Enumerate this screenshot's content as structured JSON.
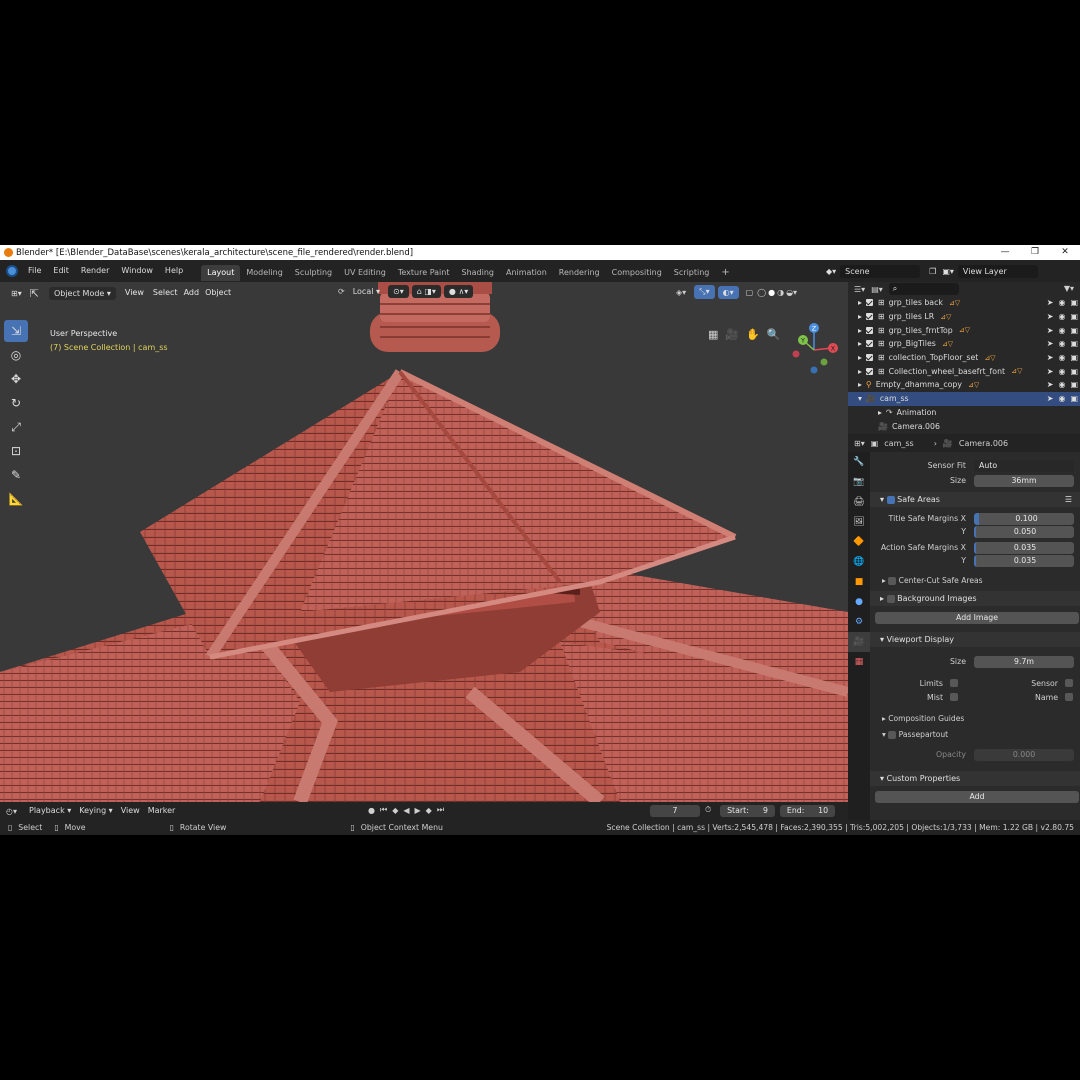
{
  "window": {
    "title": "Blender* [E:\\Blender_DataBase\\scenes\\kerala_architecture\\scene_file_rendered\\render.blend]",
    "controls": [
      "—",
      "❐",
      "✕"
    ]
  },
  "menu": [
    "File",
    "Edit",
    "Render",
    "Window",
    "Help"
  ],
  "workspaces": [
    "Layout",
    "Modeling",
    "Sculpting",
    "UV Editing",
    "Texture Paint",
    "Shading",
    "Animation",
    "Rendering",
    "Compositing",
    "Scripting"
  ],
  "active_workspace": "Layout",
  "scene_name": "Scene",
  "view_layer": "View Layer",
  "viewport": {
    "mode": "Object Mode",
    "menus": [
      "View",
      "Select",
      "Add",
      "Object"
    ],
    "orientation": "Local",
    "perspective": "User Perspective",
    "collection_path": "(7) Scene Collection | cam_ss"
  },
  "gizmo": {
    "z": "Z",
    "y": "Y",
    "x": "X"
  },
  "timeline": {
    "menus": [
      "Playback",
      "Keying",
      "View",
      "Marker"
    ],
    "current_frame": "7",
    "start_label": "Start:",
    "start": "9",
    "end_label": "End:",
    "end": "10"
  },
  "outliner": {
    "search_placeholder": "",
    "items": [
      {
        "name": "grp_tiles back",
        "sel": false,
        "check": true
      },
      {
        "name": "grp_tiles LR",
        "sel": false,
        "check": true
      },
      {
        "name": "grp_tiles_frntTop",
        "sel": false,
        "check": true
      },
      {
        "name": "grp_BigTiles",
        "sel": false,
        "check": true
      },
      {
        "name": "collection_TopFloor_set",
        "sel": false,
        "check": true
      },
      {
        "name": "Collection_wheel_basefrt_font",
        "sel": false,
        "check": true
      },
      {
        "name": "Empty_dhamma_copy",
        "sel": false,
        "check": false
      },
      {
        "name": "cam_ss",
        "sel": true,
        "check": false
      },
      {
        "name": "Animation",
        "sel": false,
        "check": false
      },
      {
        "name": "Camera.006",
        "sel": false,
        "check": false
      }
    ]
  },
  "properties": {
    "object": "cam_ss",
    "data": "Camera.006",
    "sensor_fit_label": "Sensor Fit",
    "sensor_fit": "Auto",
    "size_label": "Size",
    "size": "36mm",
    "safe_areas": "Safe Areas",
    "title_safe_x_label": "Title Safe Margins X",
    "title_safe_x": "0.100",
    "y_label": "Y",
    "title_safe_y": "0.050",
    "action_safe_x_label": "Action Safe Margins X",
    "action_safe_x": "0.035",
    "action_safe_y": "0.035",
    "center_cut": "Center-Cut Safe Areas",
    "background_images": "Background Images",
    "add_image": "Add Image",
    "viewport_display": "Viewport Display",
    "vp_size_label": "Size",
    "vp_size": "9.7m",
    "limits": "Limits",
    "sensor": "Sensor",
    "mist": "Mist",
    "name": "Name",
    "composition_guides": "Composition Guides",
    "passepartout": "Passepartout",
    "opacity_label": "Opacity",
    "opacity": "0.000",
    "custom_properties": "Custom Properties",
    "add": "Add"
  },
  "status": {
    "select": "Select",
    "move": "Move",
    "rotate": "Rotate View",
    "context": "Object Context Menu",
    "stats": "Scene Collection | cam_ss | Verts:2,545,478 | Faces:2,390,355 | Tris:5,002,205 | Objects:1/3,733 | Mem: 1.22 GB | v2.80.75"
  },
  "colors": {
    "accent": "#4772b3",
    "roof": "#b8554a",
    "orange": "#e87d0d"
  }
}
